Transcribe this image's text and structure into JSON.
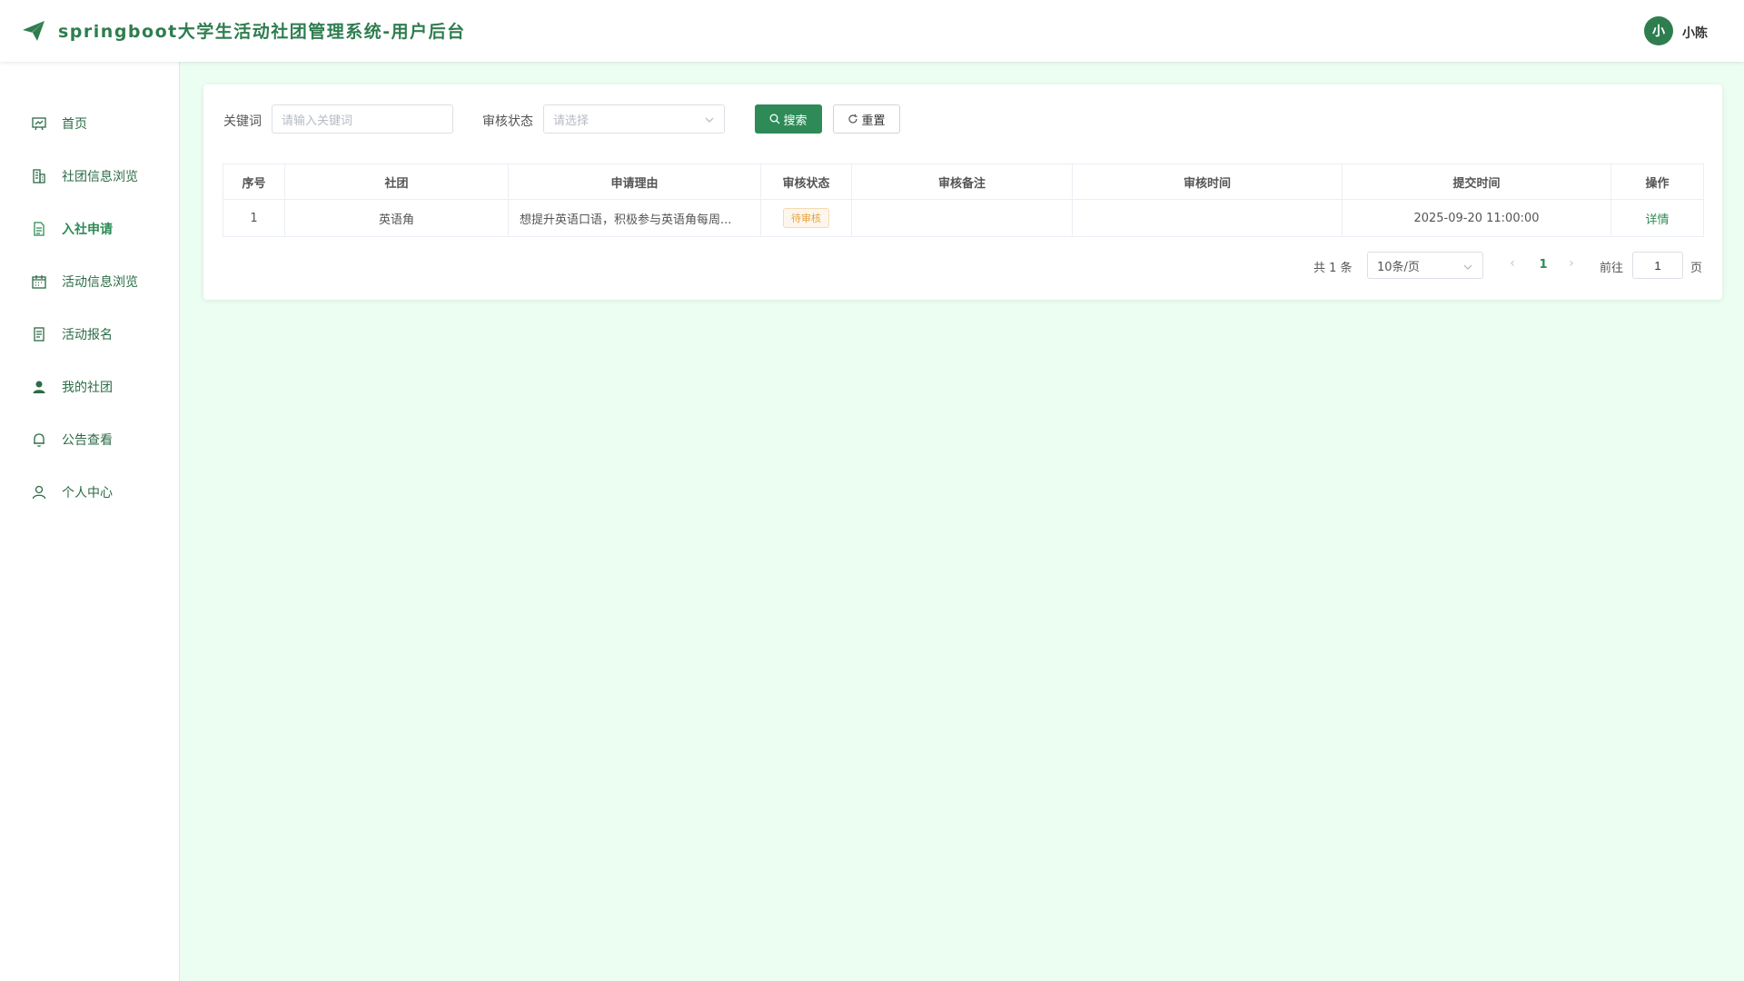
{
  "header": {
    "title": "springboot大学生活动社团管理系统-用户后台",
    "user": {
      "avatar_char": "小",
      "name": "小陈"
    }
  },
  "colors": {
    "primary": "#2e8b57",
    "background": "#ecfdf2",
    "pending": "#e6a23c"
  },
  "sidebar": {
    "items": [
      {
        "label": "首页",
        "icon": "chart-board-icon",
        "active": false
      },
      {
        "label": "社团信息浏览",
        "icon": "building-icon",
        "active": false
      },
      {
        "label": "入社申请",
        "icon": "document-icon",
        "active": true
      },
      {
        "label": "活动信息浏览",
        "icon": "calendar-icon",
        "active": false
      },
      {
        "label": "活动报名",
        "icon": "tickets-icon",
        "active": false
      },
      {
        "label": "我的社团",
        "icon": "user-solid-icon",
        "active": false
      },
      {
        "label": "公告查看",
        "icon": "bell-icon",
        "active": false
      },
      {
        "label": "个人中心",
        "icon": "user-icon",
        "active": false
      }
    ]
  },
  "filters": {
    "keyword_label": "关键词",
    "keyword_placeholder": "请输入关键词",
    "keyword_value": "",
    "status_label": "审核状态",
    "status_placeholder": "请选择",
    "search_button": "搜索",
    "reset_button": "重置"
  },
  "table": {
    "headers": [
      "序号",
      "社团",
      "申请理由",
      "审核状态",
      "审核备注",
      "审核时间",
      "提交时间",
      "操作"
    ],
    "rows": [
      {
        "index": "1",
        "club": "英语角",
        "reason": "想提升英语口语，积极参与英语角每周...",
        "status": "待审核",
        "remark": "",
        "review_time": "",
        "submit_time": "2025-09-20 11:00:00",
        "action": "详情"
      }
    ]
  },
  "pagination": {
    "total_text": "共 1 条",
    "page_size": "10条/页",
    "current_page": "1",
    "goto_label": "前往",
    "goto_value": "1",
    "page_suffix": "页"
  }
}
